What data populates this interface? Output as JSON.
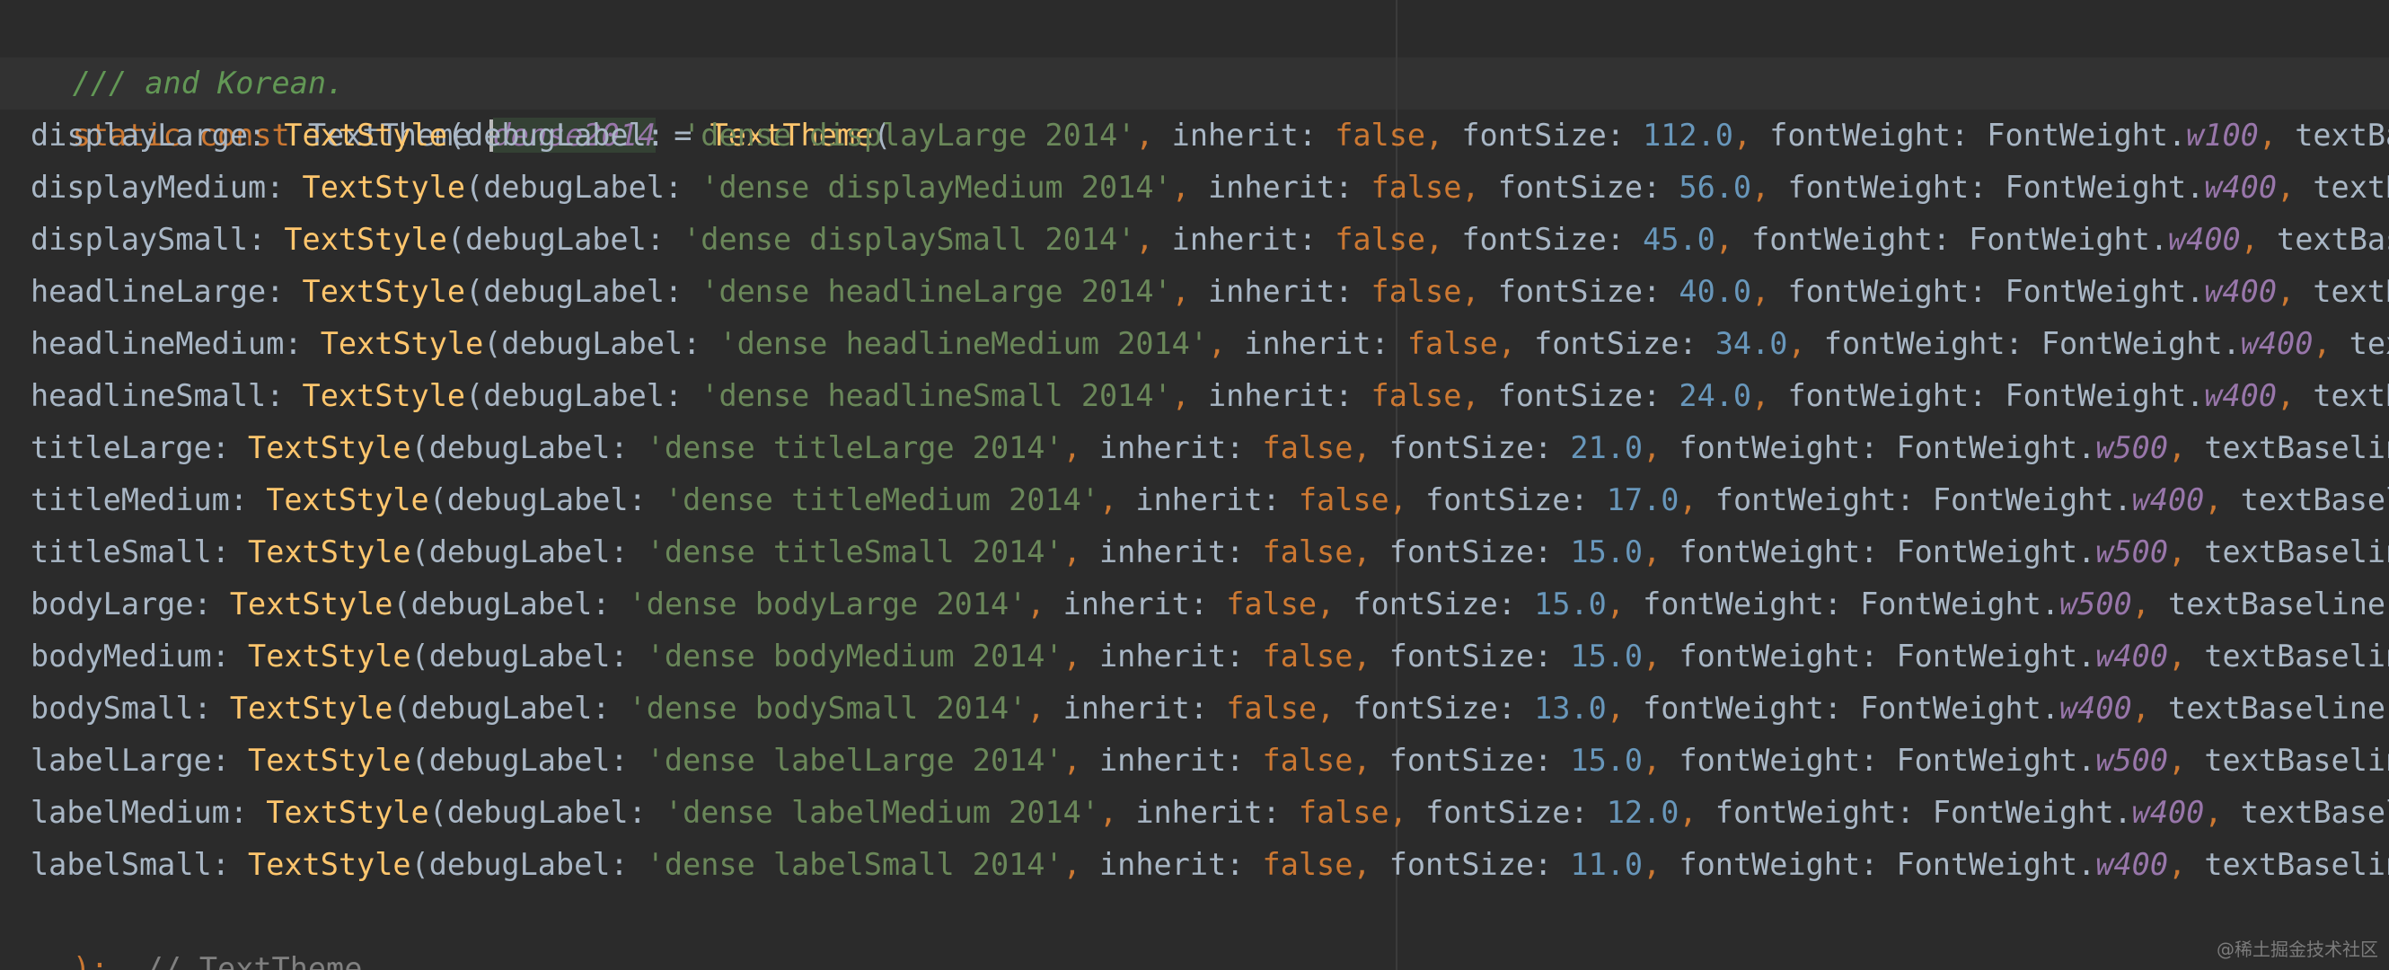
{
  "editor": {
    "doc_comment": "/// and Korean.",
    "decl": {
      "kw_static": "static",
      "kw_const": "const",
      "type": "TextTheme",
      "name": "dense2014",
      "assign": " = ",
      "ctor": "TextTheme",
      "open": "("
    },
    "entries": [
      {
        "name": "displayLarge",
        "label": "'dense displayLarge 2014'",
        "size": "112.0",
        "weight": "w100",
        "tail": "textBas"
      },
      {
        "name": "displayMedium",
        "label": "'dense displayMedium 2014'",
        "size": "56.0",
        "weight": "w400",
        "tail": "textBa"
      },
      {
        "name": "displaySmall",
        "label": "'dense displaySmall 2014'",
        "size": "45.0",
        "weight": "w400",
        "tail": "textBase"
      },
      {
        "name": "headlineLarge",
        "label": "'dense headlineLarge 2014'",
        "size": "40.0",
        "weight": "w400",
        "tail": "textBa"
      },
      {
        "name": "headlineMedium",
        "label": "'dense headlineMedium 2014'",
        "size": "34.0",
        "weight": "w400",
        "tail": "tex"
      },
      {
        "name": "headlineSmall",
        "label": "'dense headlineSmall 2014'",
        "size": "24.0",
        "weight": "w400",
        "tail": "textBa"
      },
      {
        "name": "titleLarge",
        "label": "'dense titleLarge 2014'",
        "size": "21.0",
        "weight": "w500",
        "tail": "textBaselin"
      },
      {
        "name": "titleMedium",
        "label": "'dense titleMedium 2014'",
        "size": "17.0",
        "weight": "w400",
        "tail": "textBaseli"
      },
      {
        "name": "titleSmall",
        "label": "'dense titleSmall 2014'",
        "size": "15.0",
        "weight": "w500",
        "tail": "textBaselin"
      },
      {
        "name": "bodyLarge",
        "label": "'dense bodyLarge 2014'",
        "size": "15.0",
        "weight": "w500",
        "tail": "textBaseline:"
      },
      {
        "name": "bodyMedium",
        "label": "'dense bodyMedium 2014'",
        "size": "15.0",
        "weight": "w400",
        "tail": "textBaselin"
      },
      {
        "name": "bodySmall",
        "label": "'dense bodySmall 2014'",
        "size": "13.0",
        "weight": "w400",
        "tail": "textBaseline:"
      },
      {
        "name": "labelLarge",
        "label": "'dense labelLarge 2014'",
        "size": "15.0",
        "weight": "w500",
        "tail": "textBaselin"
      },
      {
        "name": "labelMedium",
        "label": "'dense labelMedium 2014'",
        "size": "12.0",
        "weight": "w400",
        "tail": "textBaseli"
      },
      {
        "name": "labelSmall",
        "label": "'dense labelSmall 2014'",
        "size": "11.0",
        "weight": "w400",
        "tail": "textBaselin"
      }
    ],
    "tokens": {
      "ctor": "TextStyle",
      "debug_key": "debugLabel: ",
      "inherit_key": "inherit: ",
      "inherit_val": "false",
      "size_key": "fontSize: ",
      "weight_key": "fontWeight: FontWeight."
    },
    "closing": {
      "paren": ")",
      "semi": ";",
      "comment": "// TextTheme"
    }
  },
  "watermark": "@稀土掘金技术社区"
}
